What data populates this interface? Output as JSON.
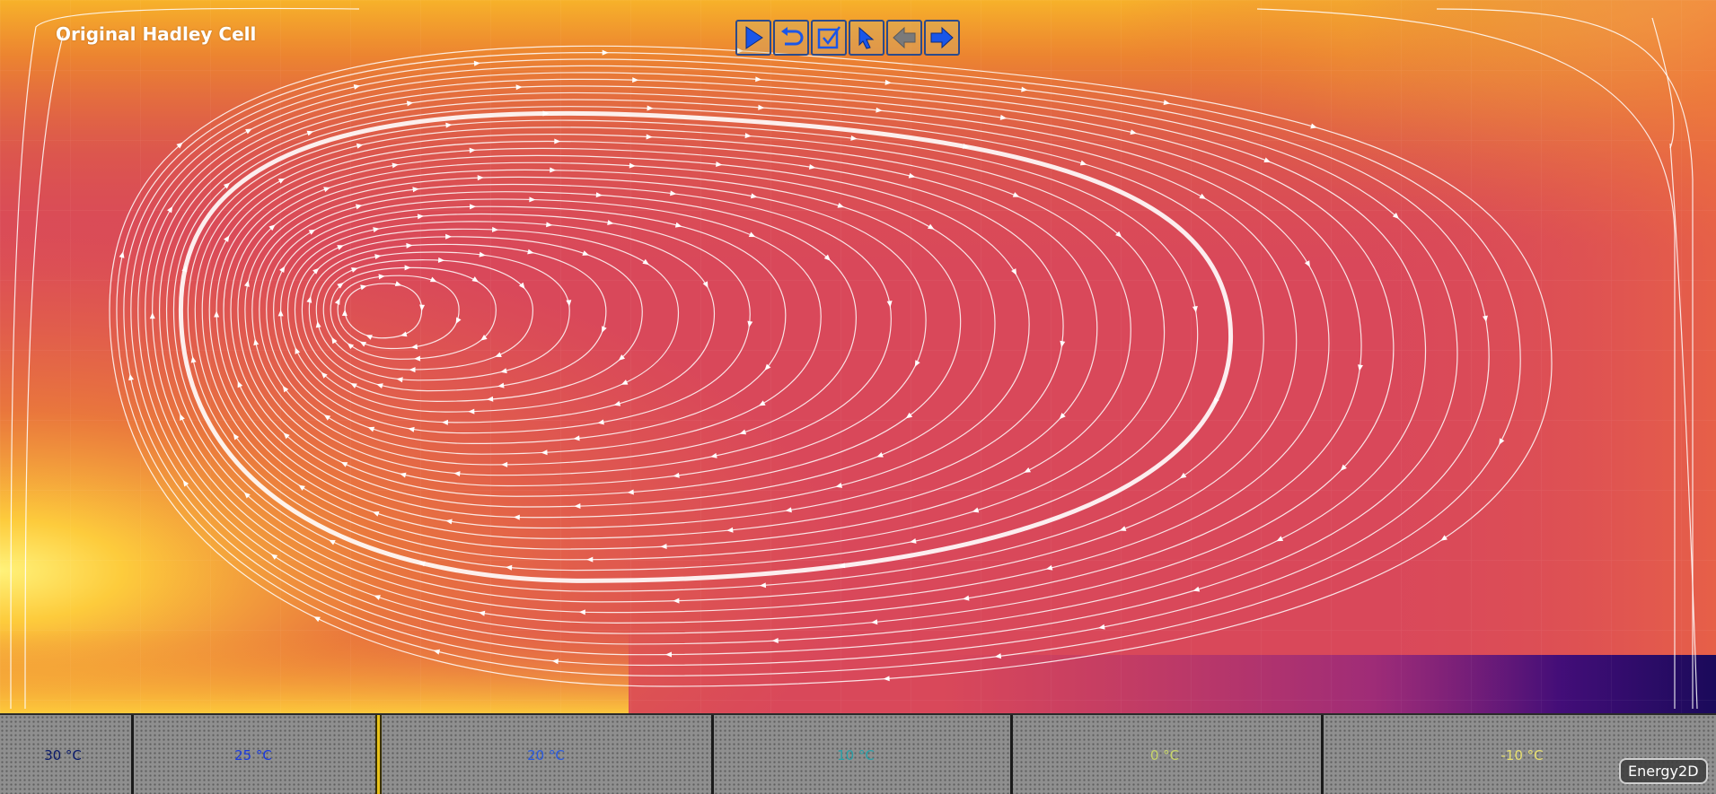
{
  "simulation": {
    "title": "Original Hadley Cell"
  },
  "toolbar": {
    "buttons": [
      {
        "name": "run-button",
        "icon": "play-icon",
        "enabled": true
      },
      {
        "name": "reset-button",
        "icon": "reset-icon",
        "enabled": true
      },
      {
        "name": "reload-button",
        "icon": "reload-icon",
        "enabled": true
      },
      {
        "name": "select-button",
        "icon": "pointer-icon",
        "enabled": true
      },
      {
        "name": "previous-button",
        "icon": "arrow-left-icon",
        "enabled": false
      },
      {
        "name": "next-button",
        "icon": "arrow-right-icon",
        "enabled": true
      }
    ],
    "accent_color": "#1a56e8",
    "disabled_color": "#7a7a7a"
  },
  "ground": {
    "zones": [
      {
        "label": "30 °C",
        "color": "#0a1a6a"
      },
      {
        "label": "25 °C",
        "color": "#1a3adf"
      },
      {
        "label": "20 °C",
        "color": "#2a5adf"
      },
      {
        "label": "10 °C",
        "color": "#2aa0a8"
      },
      {
        "label": "0 °C",
        "color": "#c8d66a"
      },
      {
        "label": "-10 °C",
        "color": "#e8e070"
      }
    ]
  },
  "brand": {
    "label": "Energy2D"
  },
  "colors": {
    "hot": "#ffe640",
    "warm": "#e86a30",
    "mid": "#d9485a",
    "cold": "#2a0a6a",
    "streamline": "#ffffff"
  }
}
